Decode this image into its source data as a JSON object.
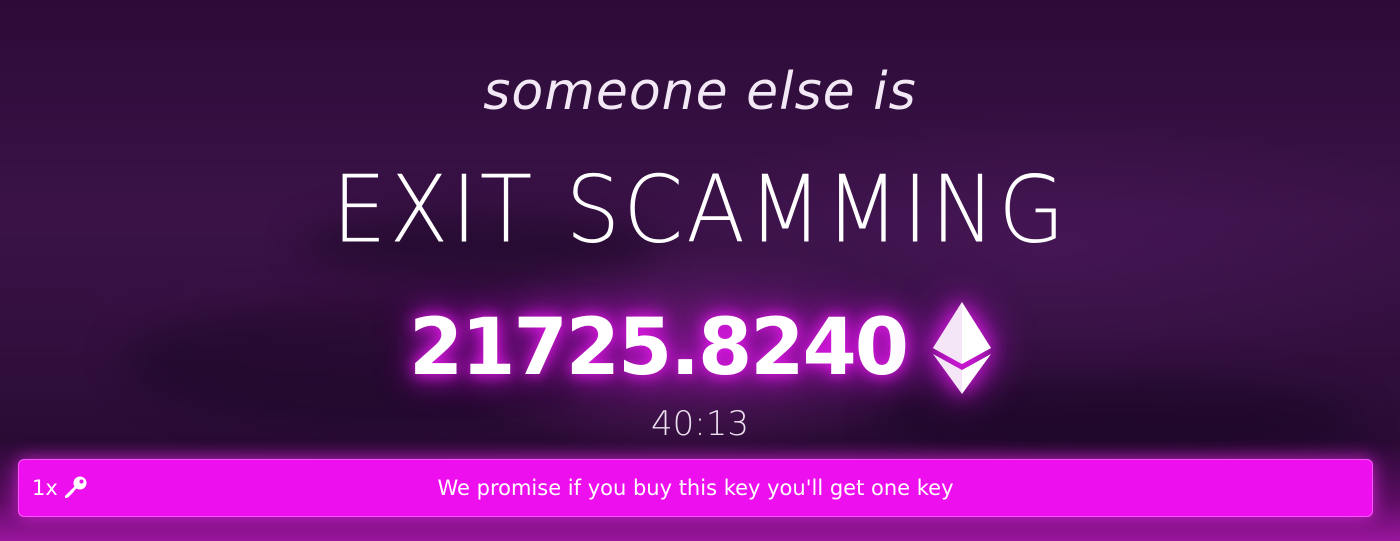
{
  "hero": {
    "subtitle": "someone else is",
    "title": "EXIT SCAMMING"
  },
  "pot": {
    "amount": "21725.8240",
    "currency_icon": "ethereum-icon"
  },
  "timer": {
    "value": "40:13"
  },
  "buy": {
    "quantity": "1x",
    "key_icon": "key-icon",
    "label": "We promise if you buy this key you'll get one key"
  },
  "colors": {
    "accent": "#ee0fee",
    "glow": "#e41be8",
    "background": "#2c0b38"
  }
}
